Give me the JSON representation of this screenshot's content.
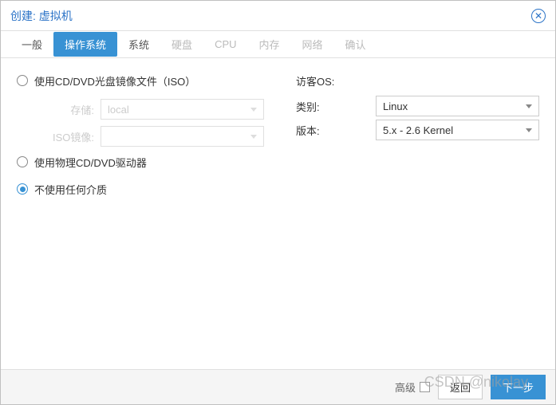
{
  "header": {
    "title": "创建: 虚拟机"
  },
  "tabs": [
    {
      "label": "一般",
      "state": "normal"
    },
    {
      "label": "操作系统",
      "state": "active"
    },
    {
      "label": "系统",
      "state": "normal"
    },
    {
      "label": "硬盘",
      "state": "disabled"
    },
    {
      "label": "CPU",
      "state": "disabled"
    },
    {
      "label": "内存",
      "state": "disabled"
    },
    {
      "label": "网络",
      "state": "disabled"
    },
    {
      "label": "确认",
      "state": "disabled"
    }
  ],
  "media": {
    "iso_radio": "使用CD/DVD光盘镜像文件（ISO）",
    "storage_label": "存储:",
    "storage_value": "local",
    "iso_image_label": "ISO镜像:",
    "iso_image_value": "",
    "cdrom_radio": "使用物理CD/DVD驱动器",
    "none_radio": "不使用任何介质"
  },
  "guest": {
    "heading": "访客OS:",
    "type_label": "类别:",
    "type_value": "Linux",
    "version_label": "版本:",
    "version_value": "5.x - 2.6 Kernel"
  },
  "footer": {
    "advanced": "高级",
    "back": "返回",
    "next": "下一步"
  },
  "watermark": "CSDN @nikolay"
}
